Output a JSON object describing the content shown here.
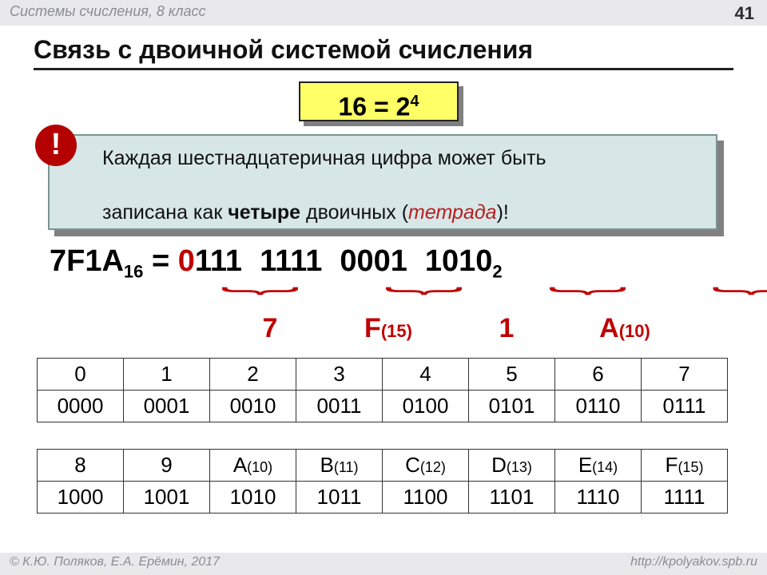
{
  "header": {
    "course": "Системы счисления, 8 класс",
    "page": "41"
  },
  "title": "Связь с двоичной системой счисления",
  "formula": {
    "base": "16 = 2",
    "exp": "4"
  },
  "info": {
    "bang": "!",
    "l1": "Каждая шестнадцатеричная цифра может быть",
    "l2a": "записана как ",
    "l2b": "четыре",
    "l2c": " двоичных (",
    "l2d": "тетрада",
    "l2e": ")!"
  },
  "eq": {
    "lhs": "7F1A",
    "lhs_sub": "16",
    "eq": " = ",
    "zero": "0",
    "g1": "111",
    "g2": "1111",
    "g3": "0001",
    "g4": "1010",
    "rhs_sub": "2"
  },
  "brace_glyph": "}",
  "labels": {
    "c1": "7",
    "c2": "F",
    "c2s": "(15)",
    "c3": "1",
    "c4": "A",
    "c4s": "(10)"
  },
  "table1": {
    "h": [
      "0",
      "1",
      "2",
      "3",
      "4",
      "5",
      "6",
      "7"
    ],
    "b": [
      "0000",
      "0001",
      "0010",
      "0011",
      "0100",
      "0101",
      "0110",
      "0111"
    ]
  },
  "table2": {
    "h": [
      "8",
      "9",
      "A",
      "B",
      "C",
      "D",
      "E",
      "F"
    ],
    "hs": [
      "",
      "",
      "(10)",
      "(11)",
      "(12)",
      "(13)",
      "(14)",
      "(15)"
    ],
    "b": [
      "1000",
      "1001",
      "1010",
      "1011",
      "1100",
      "1101",
      "1110",
      "1111"
    ]
  },
  "footer": {
    "left": "© К.Ю. Поляков, Е.А. Ерёмин, 2017",
    "right": "http://kpolyakov.spb.ru"
  }
}
